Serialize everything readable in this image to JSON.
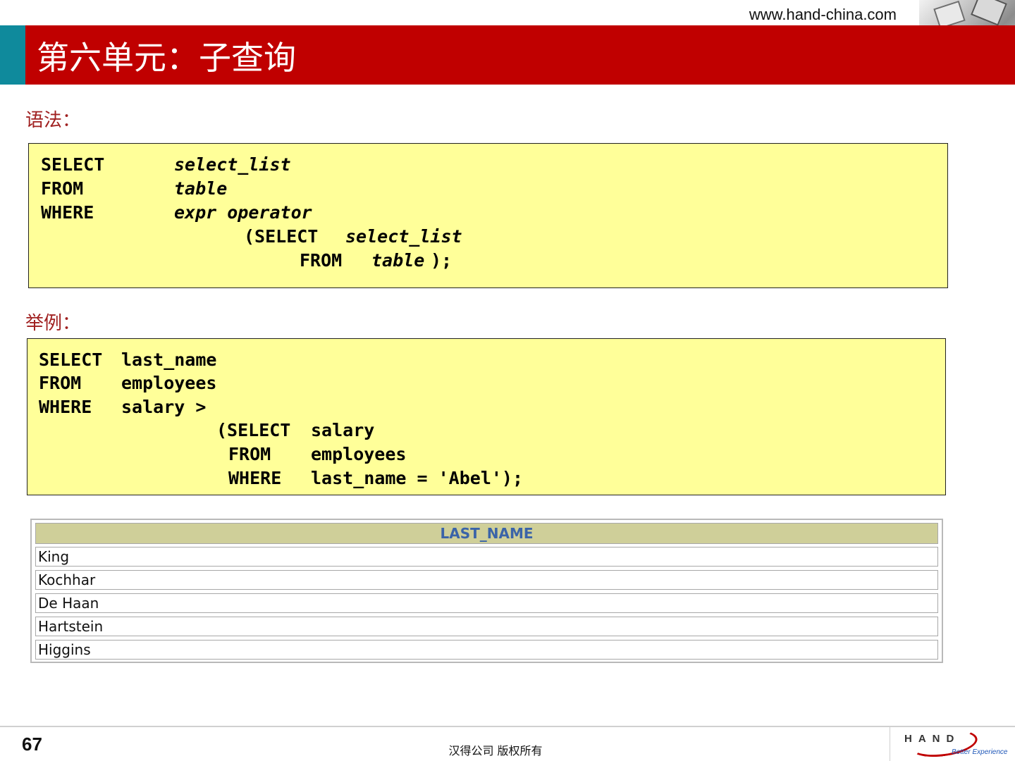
{
  "header": {
    "url": "www.hand-china.com",
    "title": "第六单元：子查询"
  },
  "syntax": {
    "label": "语法：",
    "lines": [
      {
        "kw": "SELECT",
        "arg": "select_list"
      },
      {
        "kw": "FROM",
        "arg": "table"
      },
      {
        "kw": "WHERE",
        "arg": "expr operator"
      },
      {
        "kw": "(SELECT",
        "arg": "select_list"
      },
      {
        "kw": "FROM",
        "arg": "table",
        "tail": ");"
      }
    ]
  },
  "example": {
    "label": "举例：",
    "lines": [
      {
        "kw": "SELECT",
        "arg": "last_name"
      },
      {
        "kw": "FROM",
        "arg": "employees"
      },
      {
        "kw": "WHERE",
        "arg": "salary >"
      },
      {
        "kw": "(SELECT",
        "arg": "salary"
      },
      {
        "kw": "FROM",
        "arg": "employees"
      },
      {
        "kw": "WHERE",
        "arg": "last_name = 'Abel');"
      }
    ]
  },
  "result": {
    "header": "LAST_NAME",
    "rows": [
      "King",
      "Kochhar",
      "De Haan",
      "Hartstein",
      "Higgins"
    ]
  },
  "footer": {
    "page_number": "67",
    "copyright": "汉得公司    版权所有",
    "logo_text": "HAND",
    "logo_tagline": "Better Experience"
  },
  "colors": {
    "title_bar": "#c00000",
    "accent": "#0f8a9c",
    "code_bg": "#ffff99",
    "label": "#a02020",
    "result_header_bg": "#cfcf99",
    "result_header_text": "#3b64a8"
  }
}
